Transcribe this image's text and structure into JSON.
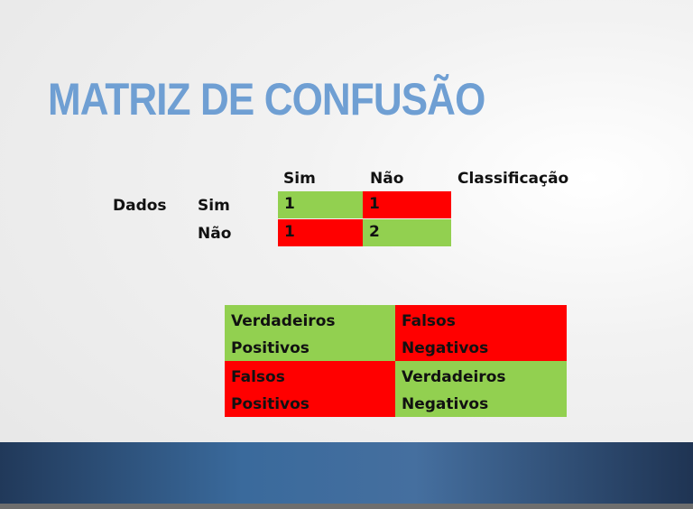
{
  "slide": {
    "title": "MATRIZ DE CONFUSÃO",
    "col_headers": [
      "Sim",
      "Não",
      "Classificação"
    ],
    "row_group_label": "Dados",
    "row_labels": [
      "Sim",
      "Não"
    ],
    "matrix": [
      [
        "1",
        "1"
      ],
      [
        "1",
        "2"
      ]
    ],
    "legend": {
      "tp": [
        "Verdadeiros",
        "Positivos"
      ],
      "fn": [
        "Falsos",
        "Negativos"
      ],
      "fp": [
        "Falsos",
        "Positivos"
      ],
      "tn": [
        "Verdadeiros",
        "Negativos"
      ]
    },
    "colors": {
      "correct": "#92d050",
      "error": "#ff0000",
      "title": "#6f9fd3"
    }
  }
}
